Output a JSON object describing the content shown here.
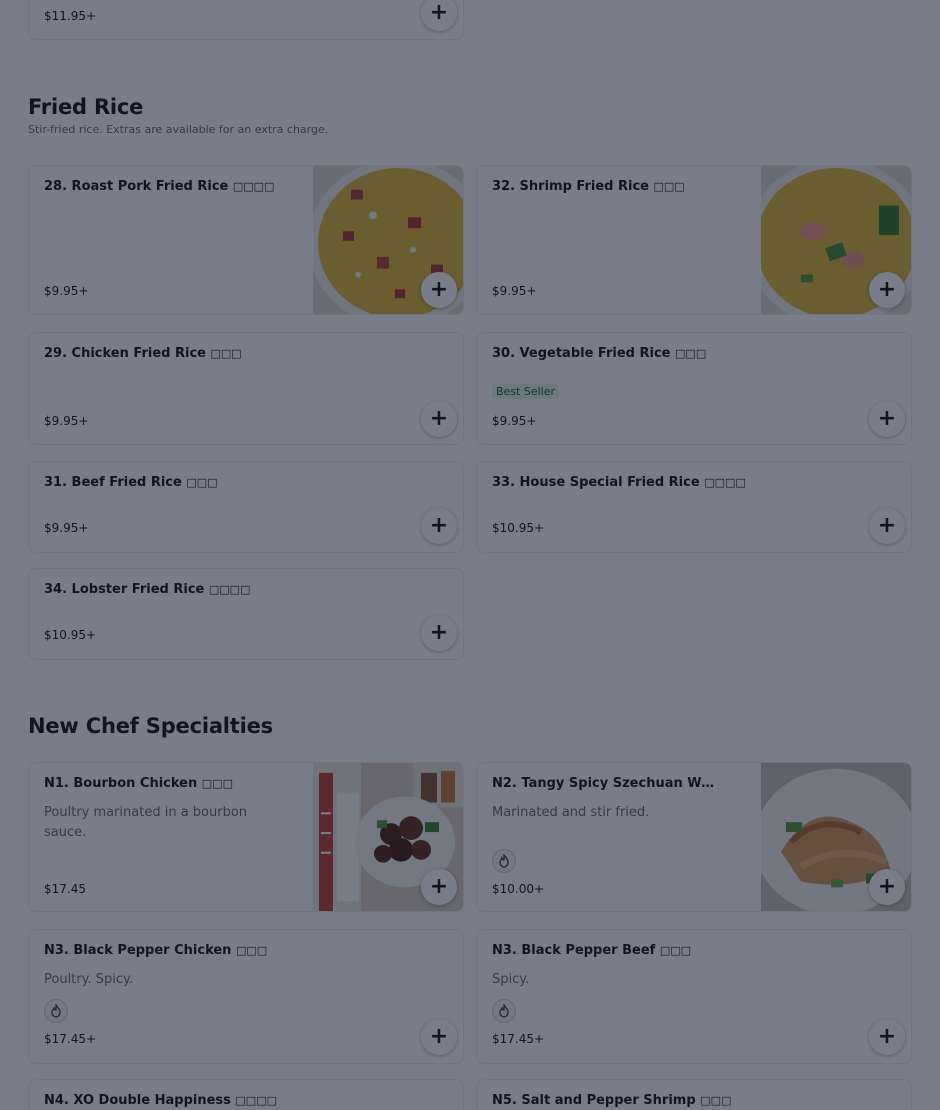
{
  "top_item": {
    "price": "$11.95+"
  },
  "sections": {
    "fried_rice": {
      "title": "Fried Rice",
      "subtitle": "Stir-fried rice. Extras are available for an extra charge."
    },
    "new_chef": {
      "title": "New Chef Specialties"
    }
  },
  "items": {
    "i28": {
      "name": "28. Roast Pork Fried Rice",
      "chinese": "□□□□",
      "price": "$9.95+"
    },
    "i32": {
      "name": "32. Shrimp Fried Rice",
      "chinese": "□□□",
      "price": "$9.95+"
    },
    "i29": {
      "name": "29. Chicken Fried Rice",
      "chinese": "□□□",
      "price": "$9.95+"
    },
    "i30": {
      "name": "30. Vegetable Fried Rice",
      "chinese": "□□□",
      "badge": "Best Seller",
      "price": "$9.95+"
    },
    "i31": {
      "name": "31. Beef Fried Rice",
      "chinese": "□□□",
      "price": "$9.95+"
    },
    "i33": {
      "name": "33. House Special Fried Rice",
      "chinese": "□□□□",
      "price": "$10.95+"
    },
    "i34": {
      "name": "34. Lobster Fried Rice",
      "chinese": "□□□□",
      "price": "$10.95+"
    },
    "n1": {
      "name": "N1. Bourbon Chicken",
      "chinese": "□□□",
      "description": "Poultry marinated in a bourbon sauce.",
      "price": "$17.45"
    },
    "n2": {
      "name": "N2. Tangy Spicy Szechuan Won...",
      "description": "Marinated and stir fried.",
      "price": "$10.00+"
    },
    "n3c": {
      "name": "N3. Black Pepper Chicken",
      "chinese": "□□□",
      "description": "Poultry. Spicy.",
      "price": "$17.45+"
    },
    "n3b": {
      "name": "N3. Black Pepper Beef",
      "chinese": "□□□",
      "description": "Spicy.",
      "price": "$17.45+"
    },
    "n4": {
      "name": "N4. XO Double Happiness",
      "chinese": "□□□□"
    },
    "n5": {
      "name": "N5. Salt and Pepper Shrimp",
      "chinese": "□□□"
    }
  },
  "add_icon": "+",
  "icons": {
    "add": "plus-icon",
    "spicy": "flame-icon"
  },
  "colors": {
    "overlay": "#0a1228",
    "badge_text": "#1f6e44",
    "badge_bg": "#e5f4ec"
  }
}
